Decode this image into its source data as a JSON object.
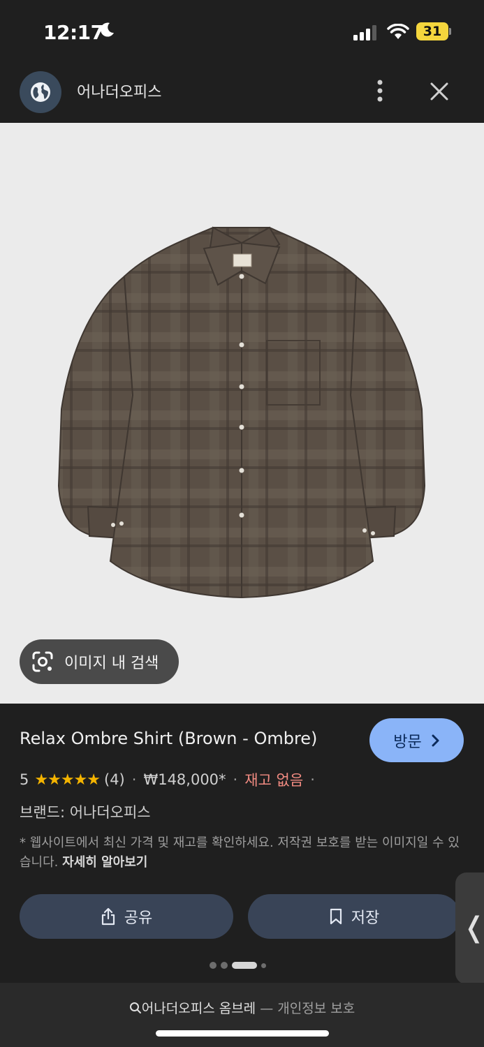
{
  "status_bar": {
    "time": "12:17",
    "battery": "31"
  },
  "topbar": {
    "site_name": "어나더오피스"
  },
  "image": {
    "lens_label": "이미지 내 검색"
  },
  "product": {
    "title": "Relax Ombre Shirt (Brown - Ombre)",
    "visit_label": "방문",
    "rating": "5",
    "stars": "★★★★★",
    "review_count": "(4)",
    "price": "₩148,000*",
    "stock": "재고 없음",
    "brand": "브랜드: 어나더오피스",
    "disclaimer": "* 웹사이트에서 최신 가격 및 재고를 확인하세요. 저작권 보호를 받는 이미지일 수 있습니다.",
    "learn_more": "자세히 알아보기"
  },
  "actions": {
    "share_label": "공유",
    "save_label": "저장"
  },
  "side_tab": {
    "glyph": "❬"
  },
  "bottom": {
    "query": "어나더오피스 옴브레",
    "separator": " — ",
    "privacy": "개인정보 보호"
  },
  "colors": {
    "accent": "#8ab4f8",
    "stock_red": "#f28b82",
    "star": "#f4b400",
    "shirt": "#5a4f45"
  }
}
